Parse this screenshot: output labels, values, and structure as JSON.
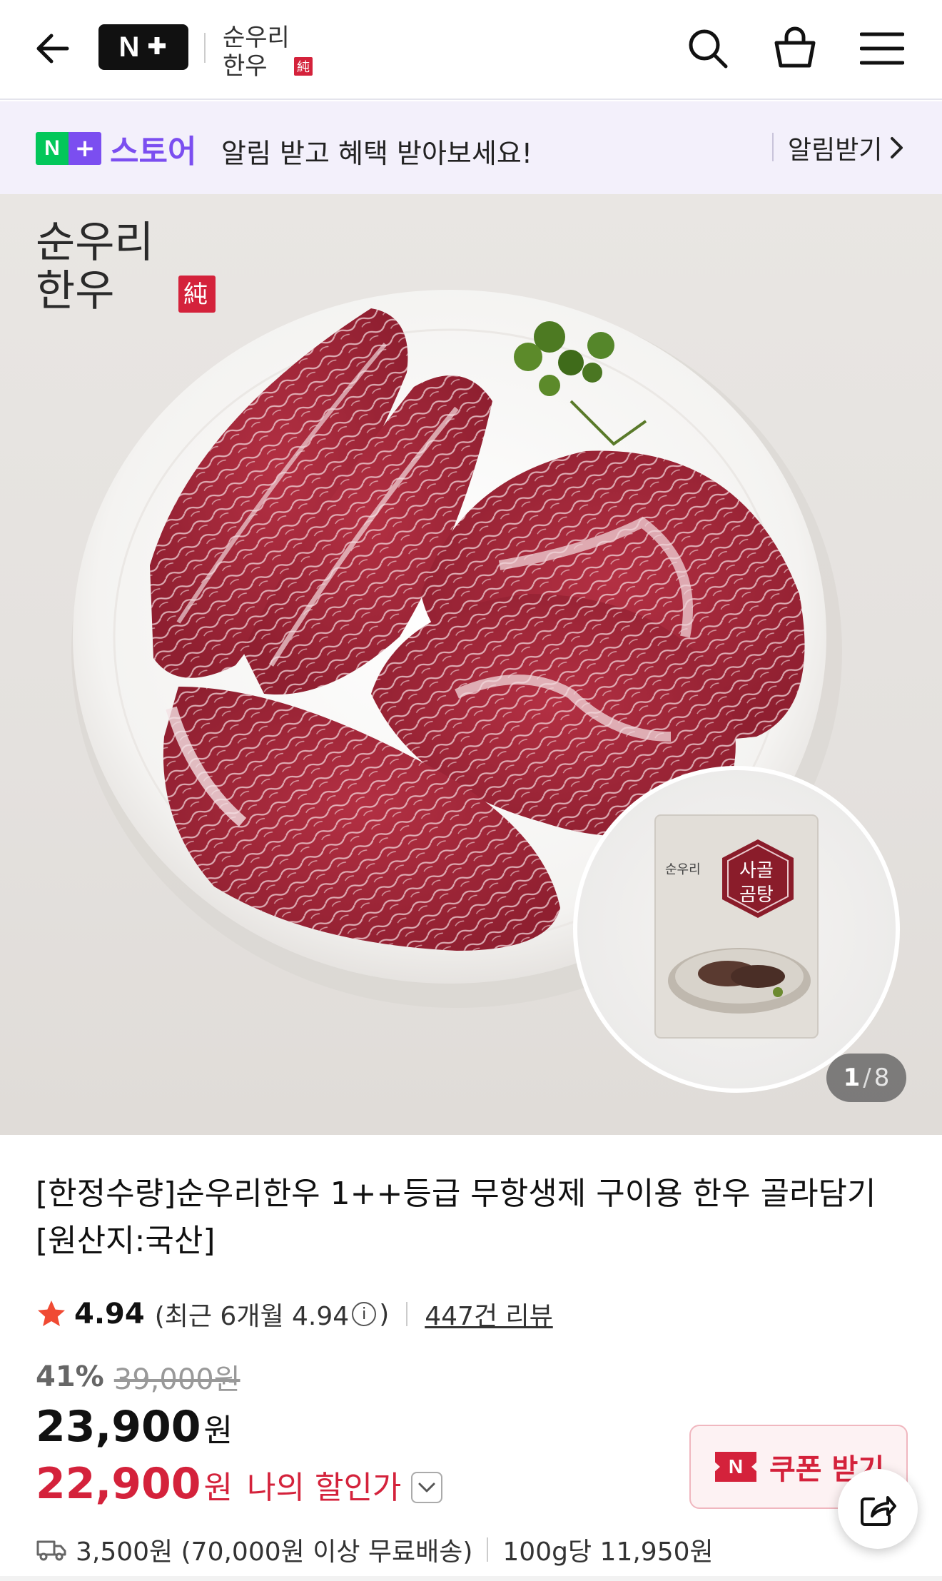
{
  "header": {
    "np_letter": "N",
    "brand_line1": "순우리",
    "brand_line2": "한우",
    "brand_seal": "純"
  },
  "banner": {
    "store_n": "N",
    "store_plus": "+",
    "store_name": "스토어",
    "message": "알림 받고 혜택 받아보세요!",
    "notify_label": "알림받기"
  },
  "hero": {
    "brand_line1": "순우리",
    "brand_line2": "한우",
    "brand_seal": "純",
    "package_brand": "순우리",
    "package_title_1": "사골",
    "package_title_2": "곰탕",
    "counter_current": "1",
    "counter_sep": "/",
    "counter_total": "8"
  },
  "product": {
    "title": "[한정수량]순우리한우 1++등급 무항생제 구이용 한우 골라담기 [원산지:국산]",
    "rating_score": "4.94",
    "recent_prefix": "(최근 6개월 4.94",
    "recent_suffix": ")",
    "info_glyph": "i",
    "reviews": "447건 리뷰",
    "discount_pct": "41%",
    "original_price": "39,000원",
    "price": "23,900",
    "price_unit": "원",
    "my_price": "22,900",
    "my_price_unit": "원",
    "my_price_label": "나의 할인가",
    "coupon_n": "N",
    "coupon_label": "쿠폰 받기",
    "shipping": "3,500원 (70,000원 이상 무료배송)",
    "unit_price": "100g당 11,950원"
  },
  "colors": {
    "accent_red": "#d4223b",
    "naver_green": "#03c75a",
    "plus_purple": "#7b4ef0"
  },
  "icons": [
    "back-arrow-icon",
    "search-icon",
    "shopping-bag-icon",
    "menu-icon",
    "chevron-right-icon",
    "star-icon",
    "info-icon",
    "chevron-down-icon",
    "share-icon",
    "truck-icon"
  ]
}
